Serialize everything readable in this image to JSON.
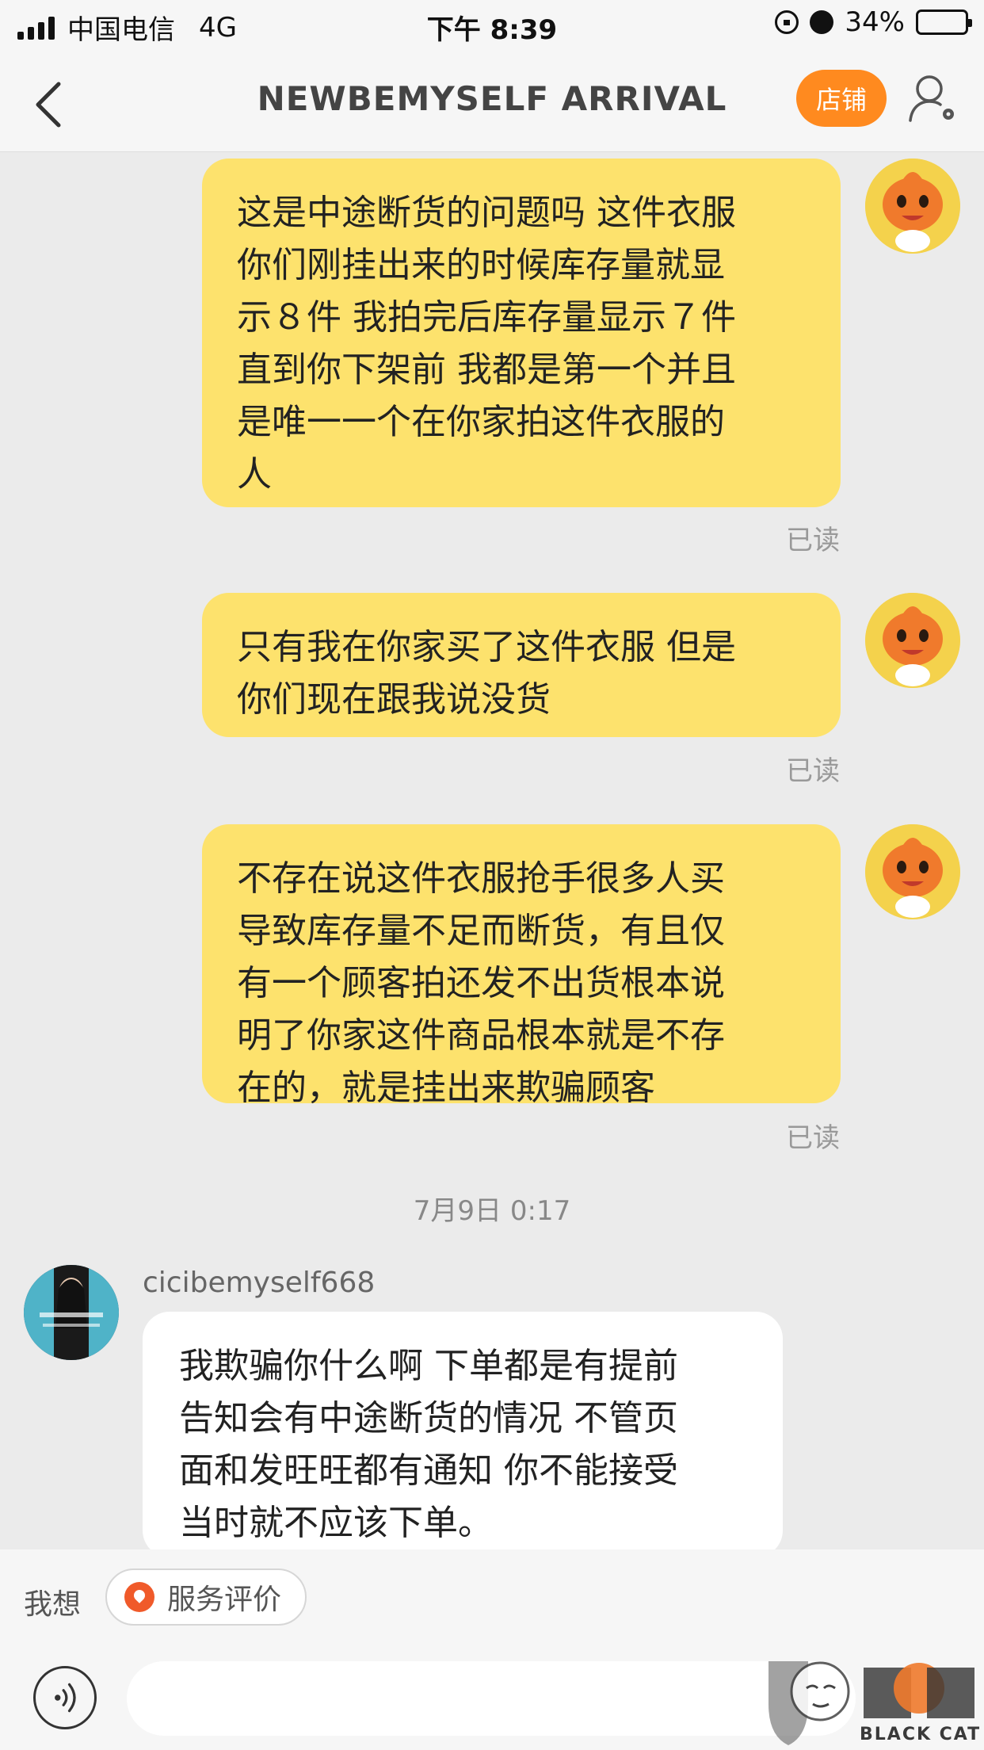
{
  "status_bar": {
    "carrier": "中国电信",
    "network": "4G",
    "time": "下午 8:39",
    "battery_percent": "34%",
    "battery_level": 0.34
  },
  "header": {
    "title": "NEWBEMYSELF ARRIVAL",
    "store_button": "店铺",
    "back_icon": "chevron-left-icon",
    "profile_icon": "user-settings-icon"
  },
  "messages": [
    {
      "direction": "outgoing",
      "text": "这是中途断货的问题吗 这件衣服\n你们刚挂出来的时候库存量就显\n示８件 我拍完后库存量显示７件\n直到你下架前 我都是第一个并且\n是唯一一个在你家拍这件衣服的\n人",
      "status": "已读"
    },
    {
      "direction": "outgoing",
      "text": "只有我在你家买了这件衣服 但是\n你们现在跟我说没货",
      "status": "已读"
    },
    {
      "direction": "outgoing",
      "text": "不存在说这件衣服抢手很多人买\n导致库存量不足而断货，有且仅\n有一个顾客拍还发不出货根本说\n明了你家这件商品根本就是不存\n在的，就是挂出来欺骗顾客",
      "status": "已读"
    }
  ],
  "timestamp": "7月9日 0:17",
  "incoming": {
    "sender": "cicibemyself668",
    "text": "我欺骗你什么啊 下单都是有提前\n告知会有中途断货的情况 不管页\n面和发旺旺都有通知 你不能接受\n当时就不应该下单。"
  },
  "quick_bar": {
    "label": "我想",
    "chip": "服务评价"
  },
  "input": {
    "placeholder": ""
  },
  "watermark": {
    "text": "BLACK CAT"
  },
  "colors": {
    "outgoing_bubble": "#fde26d",
    "incoming_bubble": "#ffffff",
    "background": "#ebebeb",
    "store_button": "#ff8a1f"
  }
}
